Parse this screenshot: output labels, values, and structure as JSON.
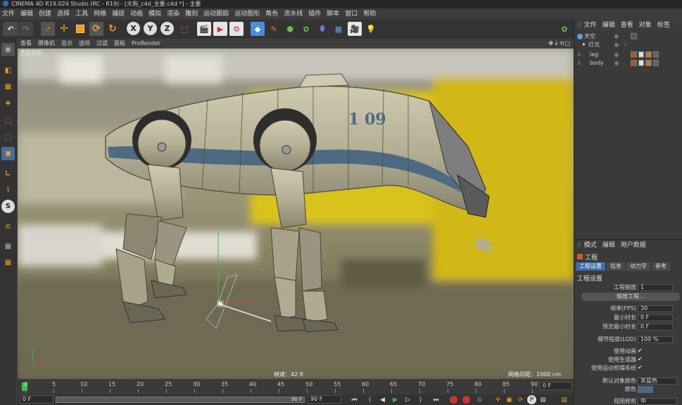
{
  "window": {
    "title": "CINEMA 4D R19.024 Studio (RC - R19) - [大狗_c4d_主要.c4d *] - 主要"
  },
  "main_menu": [
    "文件",
    "编辑",
    "创建",
    "选择",
    "工具",
    "网格",
    "捕捉",
    "动画",
    "模拟",
    "渲染",
    "雕刻",
    "运动跟踪",
    "运动图形",
    "角色",
    "流水线",
    "插件",
    "脚本",
    "窗口",
    "帮助"
  ],
  "toolbar": {
    "axis_x": "X",
    "axis_y": "Y",
    "axis_z": "Z"
  },
  "viewport": {
    "menu": [
      "查看",
      "摄像机",
      "显示",
      "选项",
      "过滤",
      "面板",
      "ProRender"
    ],
    "nav_icons": "✥↓⟲▢",
    "name": "透视视图",
    "status_speed": "帧速：42.9",
    "status_grid": "网格间距：1000 cm"
  },
  "timeline": {
    "ticks": [
      "0",
      "5",
      "10",
      "15",
      "20",
      "25",
      "30",
      "35",
      "40",
      "45",
      "50",
      "55",
      "60",
      "65",
      "70",
      "75",
      "80",
      "85",
      "90"
    ],
    "frame_field": "0 F"
  },
  "transport": {
    "start_field": "0 F",
    "end_inner": "90 F",
    "end_field": "90 F"
  },
  "object_manager": {
    "menu": [
      "文件",
      "编辑",
      "查看",
      "对象",
      "标签"
    ],
    "objects": [
      {
        "name": "天空",
        "icon": "sky-icon"
      },
      {
        "name": "灯光",
        "icon": "light-icon"
      },
      {
        "name": "leg",
        "icon": "joint-icon"
      },
      {
        "name": "body",
        "icon": "joint-icon"
      }
    ]
  },
  "attribute_manager": {
    "menu": [
      "模式",
      "编辑",
      "用户数据"
    ],
    "header": "工程",
    "tabs": [
      "工程设置",
      "信息",
      "动力学",
      "参考"
    ],
    "section": "工程设置",
    "scale_label": "工程缩放",
    "scale_value": "1",
    "scale_button": "缩放工程...",
    "fps_label": "帧率(FPS)",
    "fps_value": "30",
    "min_time_label": "最小时长",
    "min_time_value": "0 F",
    "preview_min_label": "预览最小时长",
    "preview_min_value": "0 F",
    "lod_label": "细节程度(LOD)",
    "lod_value": "100 %",
    "use_anim_label": "使用动画",
    "use_gen_label": "使用生成器",
    "use_motion_label": "使用运动剪辑系统",
    "default_color_label": "默认对象颜色",
    "default_color_value": "灰蓝色",
    "color_label": "颜色",
    "viewport_clip_label": "视图修剪",
    "viewport_clip_value": "中"
  },
  "colors": {
    "accent_blue": "#3d6aa8",
    "robot_body": "#b5b096",
    "robot_stripe": "#4e6a82",
    "background_yellow": "#d8c21a"
  }
}
